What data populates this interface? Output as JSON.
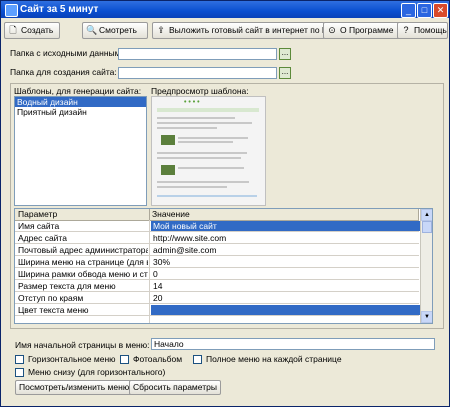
{
  "window": {
    "title": "Сайт за 5 минут",
    "controls": [
      "_",
      "□",
      "✕"
    ]
  },
  "toolbar": {
    "create": "Создать",
    "view": "Смотреть",
    "upload": "Выложить готовый сайт в интернет по FTP",
    "about": "О Программе",
    "help": "Помощь"
  },
  "paths": {
    "source_label": "Папка с исходными данными:",
    "source_value": "",
    "target_label": "Папка для создания сайта:",
    "target_value": "",
    "browse": "..."
  },
  "templates": {
    "label": "Шаблоны, для генерации сайта:",
    "items": [
      "Водный дизайн",
      "Приятный дизайн"
    ],
    "selected": 0,
    "preview_label": "Предпросмотр шаблона:"
  },
  "params": {
    "col_param": "Параметр",
    "col_value": "Значение",
    "rows": [
      {
        "k": "Имя сайта",
        "v": "Мой новый сайт"
      },
      {
        "k": "Адрес сайта",
        "v": "http://www.site.com"
      },
      {
        "k": "Почтовый адрес администратора сайта",
        "v": "admin@site.com"
      },
      {
        "k": "Ширина меню на странице (для вертикального меню)",
        "v": "30%"
      },
      {
        "k": "Ширина рамки обвода меню и страницы",
        "v": "0"
      },
      {
        "k": "Размер текста для меню",
        "v": "14"
      },
      {
        "k": "Отступ по краям",
        "v": "20"
      },
      {
        "k": "Цвет текста меню",
        "v": ""
      }
    ],
    "selected_value_color": "#316ac5"
  },
  "options": {
    "start_page_label": "Имя начальной страницы в меню:",
    "start_page_value": "Начало",
    "horizontal_menu": "Горизонтальное меню",
    "photo_album": "Фотоальбом",
    "full_menu": "Полное меню на каждой странице",
    "bottom_menu": "Меню снизу (для горизонтального)",
    "edit_menu": "Посмотреть/изменить меню",
    "reset": "Сбросить параметры"
  }
}
